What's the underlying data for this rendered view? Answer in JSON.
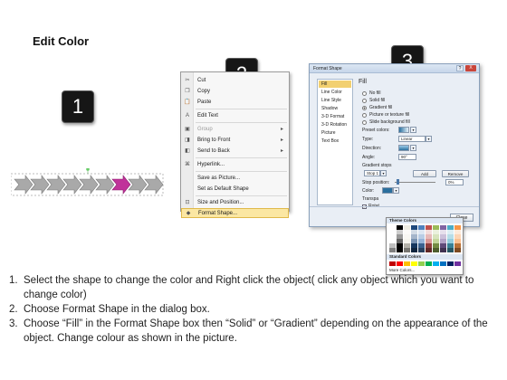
{
  "title": "Edit Color",
  "steps": [
    "1",
    "2",
    "3"
  ],
  "context_menu": {
    "items": [
      {
        "label": "Cut",
        "icon": "scissors-icon",
        "disabled": false,
        "sub": false
      },
      {
        "label": "Copy",
        "icon": "copy-icon",
        "disabled": false,
        "sub": false
      },
      {
        "label": "Paste",
        "icon": "paste-icon",
        "disabled": false,
        "sub": false
      },
      {
        "label": "Edit Text",
        "icon": "edit-text-icon",
        "disabled": false,
        "sub": false
      },
      {
        "label": "Group",
        "icon": "group-icon",
        "disabled": true,
        "sub": true
      },
      {
        "label": "Bring to Front",
        "icon": "bring-front-icon",
        "disabled": false,
        "sub": true
      },
      {
        "label": "Send to Back",
        "icon": "send-back-icon",
        "disabled": false,
        "sub": true
      },
      {
        "label": "Hyperlink...",
        "icon": "hyperlink-icon",
        "disabled": false,
        "sub": false
      },
      {
        "label": "Save as Picture...",
        "icon": "",
        "disabled": false,
        "sub": false
      },
      {
        "label": "Set as Default Shape",
        "icon": "",
        "disabled": false,
        "sub": false
      },
      {
        "label": "Size and Position...",
        "icon": "size-icon",
        "disabled": false,
        "sub": false
      },
      {
        "label": "Format Shape...",
        "icon": "format-shape-icon",
        "disabled": false,
        "sub": false,
        "highlight": true
      }
    ]
  },
  "dialog": {
    "title": "Format Shape",
    "help": "?",
    "close_x": "X",
    "categories": [
      "Fill",
      "Line Color",
      "Line Style",
      "Shadow",
      "3-D Format",
      "3-D Rotation",
      "Picture",
      "Text Box"
    ],
    "fill_header": "Fill",
    "options": [
      "No fill",
      "Solid fill",
      "Gradient fill",
      "Picture or texture fill",
      "Slide background fill"
    ],
    "preset_colors": "Preset colors:",
    "type_label": "Type:",
    "type_value": "Linear",
    "direction_label": "Direction:",
    "angle_label": "Angle:",
    "angle_value": "90°",
    "gradient_stops": "Gradient stops",
    "stop_value": "Stop 1",
    "add_label": "Add",
    "remove_label": "Remove",
    "stop_position": "Stop position:",
    "stop_position_value": "0%",
    "color_label": "Color:",
    "transparency_label": "Transpa",
    "rotate_label": "Rotat",
    "close_button": "Close"
  },
  "palette": {
    "theme_header": "Theme Colors",
    "standard_header": "Standard Colors",
    "more": "More Colors...",
    "theme_colors": [
      "#ffffff",
      "#000000",
      "#eeece1",
      "#1f497d",
      "#4f81bd",
      "#c0504d",
      "#9bbb59",
      "#8064a2",
      "#4bacc6",
      "#f79646"
    ],
    "standard_colors": [
      "#c00000",
      "#ff0000",
      "#ffc000",
      "#ffff00",
      "#92d050",
      "#00b050",
      "#00b0f0",
      "#0070c0",
      "#002060",
      "#7030a0"
    ]
  },
  "instructions": [
    {
      "num": "1.",
      "text": "Select the shape to change the color and Right click the object( click any object which you want to change color)"
    },
    {
      "num": "2.",
      "text": "Choose Format Shape in the dialog box."
    },
    {
      "num": "3.",
      "text": "Choose “Fill” in the Format Shape box then “Solid” or “Gradient” depending on the appearance of the object. Change colour as shown in the picture."
    }
  ]
}
